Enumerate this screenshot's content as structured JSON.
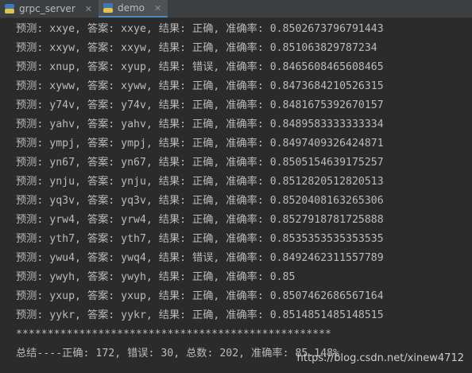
{
  "tabs": [
    {
      "label": "grpc_server",
      "icon": "python-file-icon",
      "active": false
    },
    {
      "label": "demo",
      "icon": "python-file-icon",
      "active": true
    }
  ],
  "console": {
    "lines": [
      "预测: xxye, 答案: xxye, 结果: 正确, 准确率: 0.8502673796791443",
      "预测: xxyw, 答案: xxyw, 结果: 正确, 准确率: 0.851063829787234",
      "预测: xnup, 答案: xyup, 结果: 错误, 准确率: 0.8465608465608465",
      "预测: xyww, 答案: xyww, 结果: 正确, 准确率: 0.8473684210526315",
      "预测: y74v, 答案: y74v, 结果: 正确, 准确率: 0.8481675392670157",
      "预测: yahv, 答案: yahv, 结果: 正确, 准确率: 0.8489583333333334",
      "预测: ympj, 答案: ympj, 结果: 正确, 准确率: 0.8497409326424871",
      "预测: yn67, 答案: yn67, 结果: 正确, 准确率: 0.8505154639175257",
      "预测: ynju, 答案: ynju, 结果: 正确, 准确率: 0.8512820512820513",
      "预测: yq3v, 答案: yq3v, 结果: 正确, 准确率: 0.8520408163265306",
      "预测: yrw4, 答案: yrw4, 结果: 正确, 准确率: 0.8527918781725888",
      "预测: yth7, 答案: yth7, 结果: 正确, 准确率: 0.8535353535353535",
      "预测: ywu4, 答案: ywq4, 结果: 错误, 准确率: 0.8492462311557789",
      "预测: ywyh, 答案: ywyh, 结果: 正确, 准确率: 0.85",
      "预测: yxup, 答案: yxup, 结果: 正确, 准确率: 0.8507462686567164",
      "预测: yykr, 答案: yykr, 结果: 正确, 准确率: 0.8514851485148515"
    ],
    "separator": "**************************************************",
    "summary": "总结----正确: 172, 错误: 30, 总数: 202, 准确率: 85.148%"
  },
  "watermark": "https://blog.csdn.net/xinew4712",
  "colors": {
    "background": "#2b2b2b",
    "tabbar": "#3c3f41",
    "text": "#bbbbbb",
    "tab_active_underline": "#4a88c7"
  }
}
